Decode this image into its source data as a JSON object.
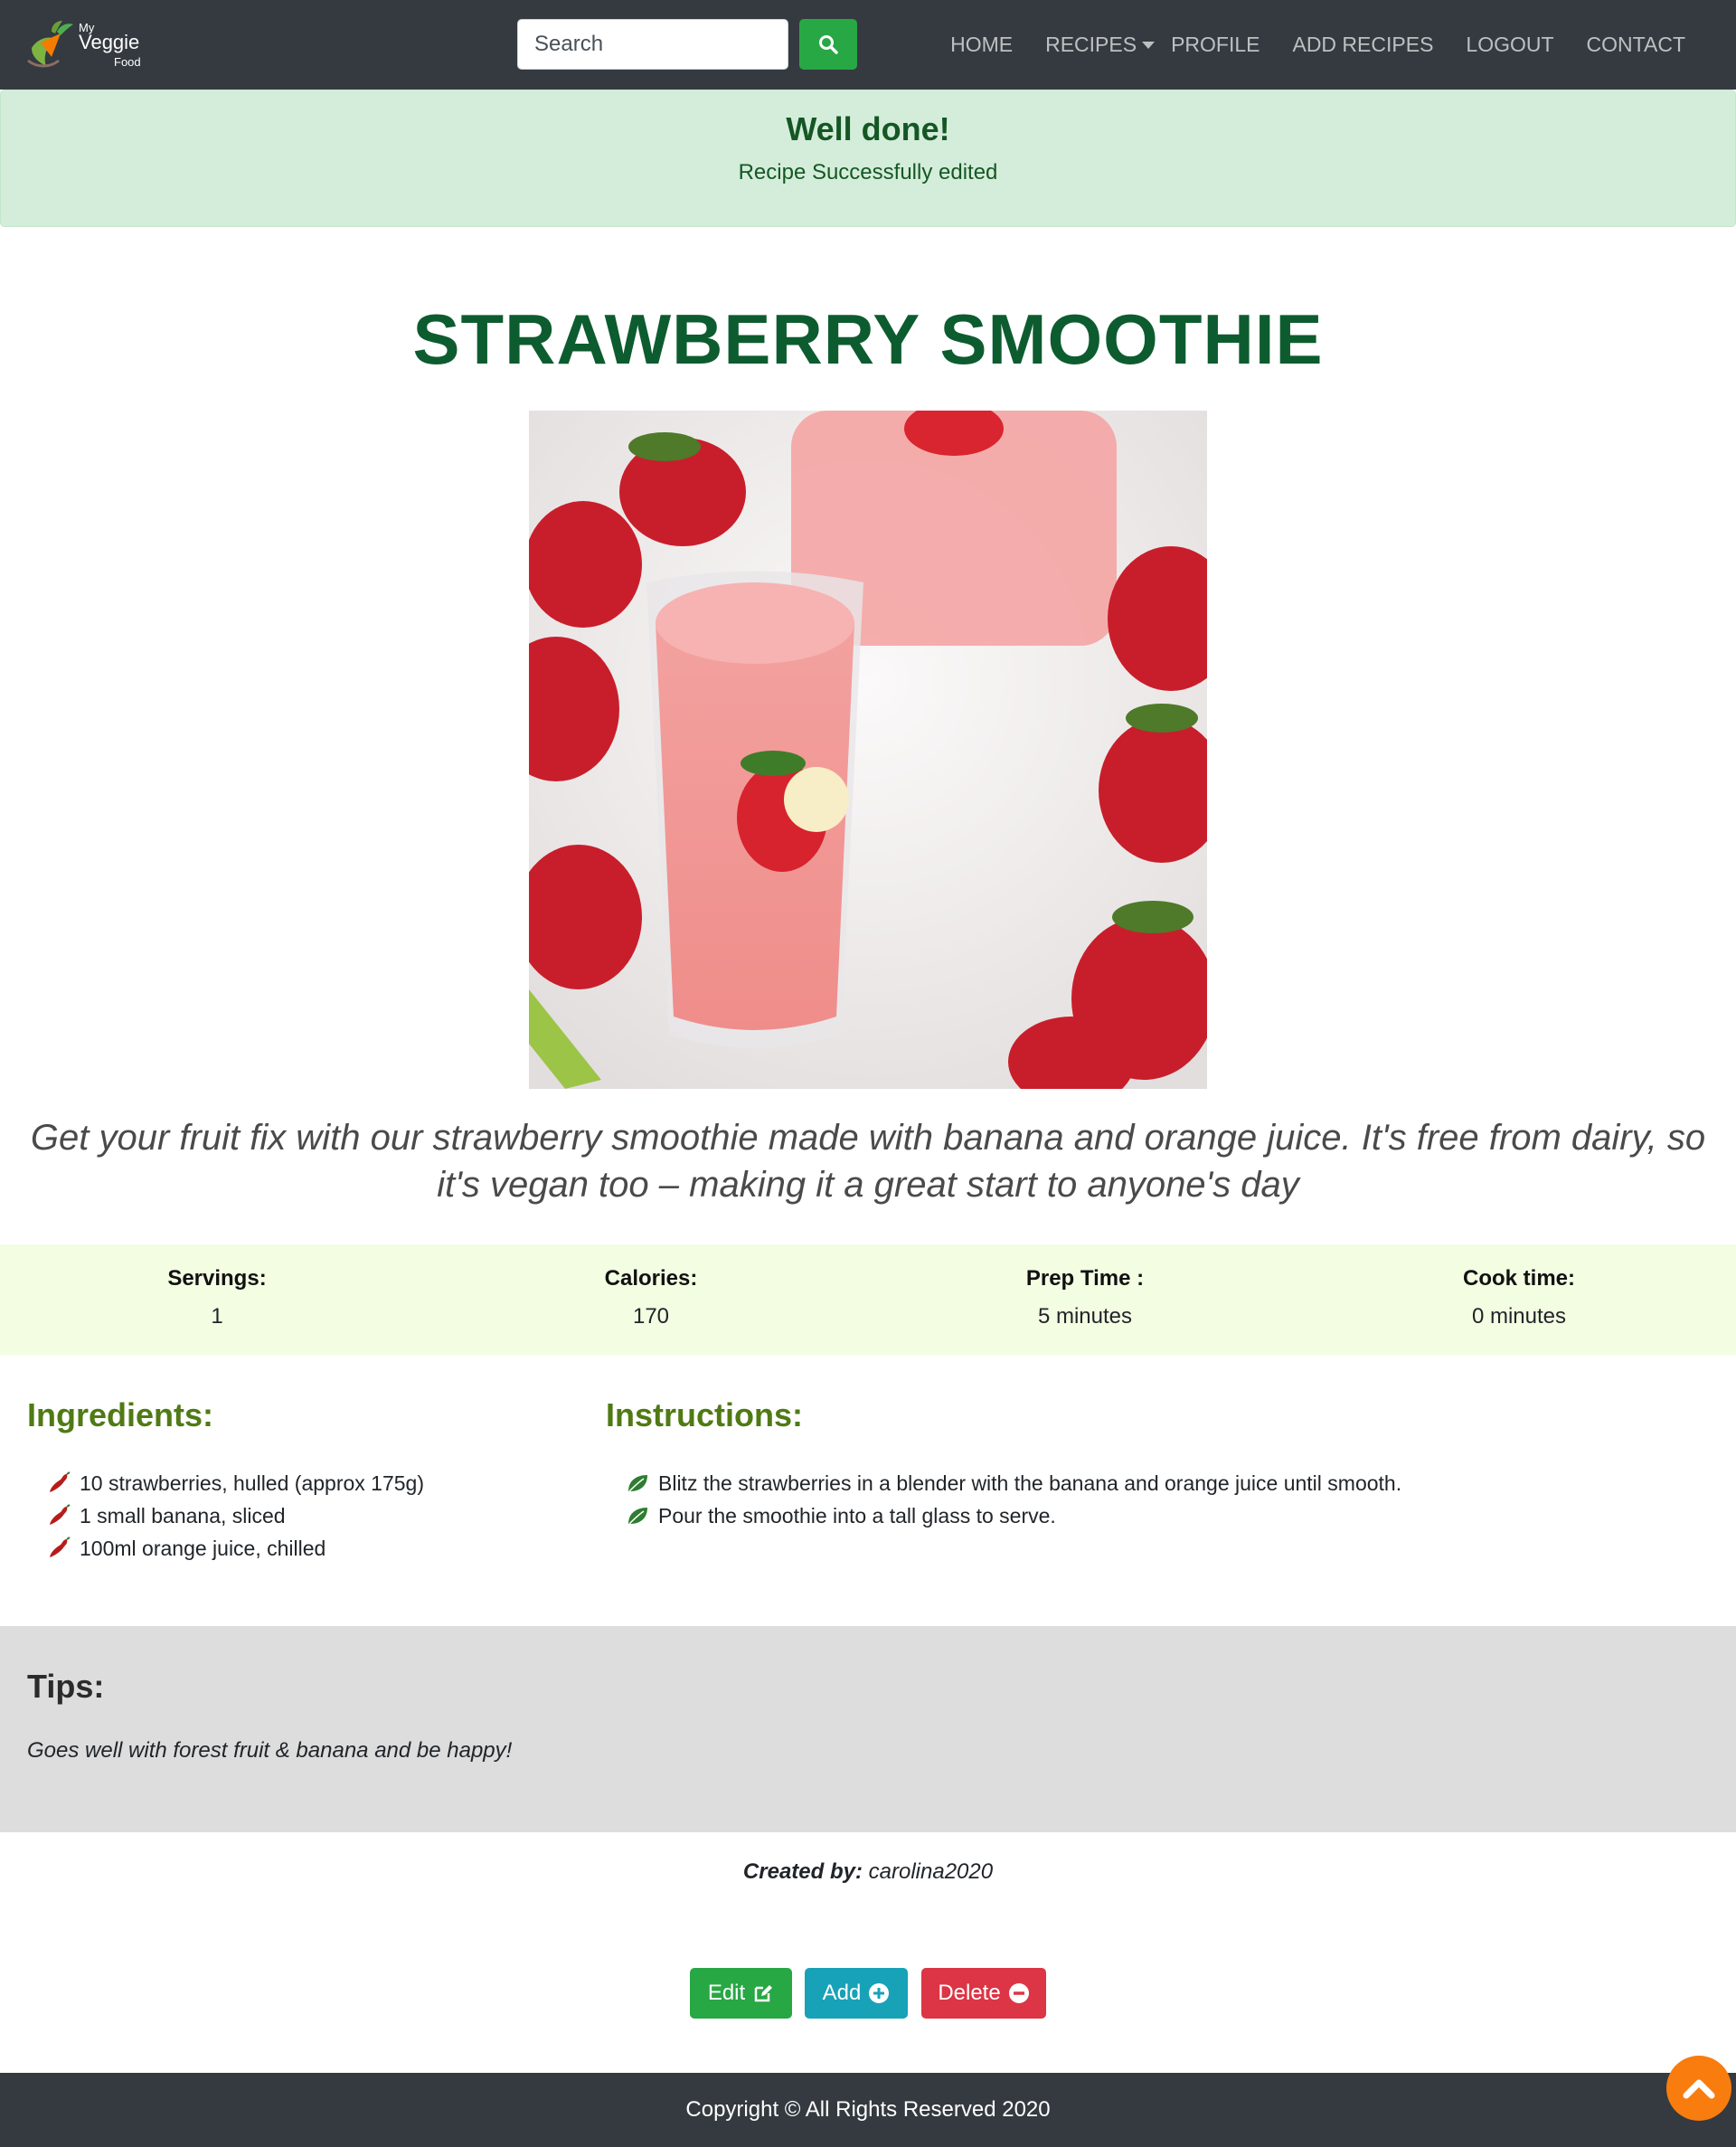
{
  "brand": {
    "line1": "My",
    "line2": "Veggie",
    "line3": "Food"
  },
  "search": {
    "placeholder": "Search"
  },
  "nav": {
    "home": "HOME",
    "recipes": "RECIPES",
    "profile": "PROFILE",
    "add_recipes": "ADD RECIPES",
    "logout": "LOGOUT",
    "contact": "CONTACT"
  },
  "alert": {
    "title": "Well done!",
    "message": "Recipe Successfully edited"
  },
  "recipe": {
    "title": "STRAWBERRY SMOOTHIE",
    "description": "Get your fruit fix with our strawberry smoothie made with banana and orange juice. It's free from dairy, so it's vegan too – making it a great start to anyone's day",
    "stats": [
      {
        "label": "Servings:",
        "value": "1"
      },
      {
        "label": "Calories:",
        "value": "170"
      },
      {
        "label": "Prep Time :",
        "value": "5 minutes"
      },
      {
        "label": "Cook time:",
        "value": "0 minutes"
      }
    ],
    "ingredients_heading": "Ingredients:",
    "ingredients": [
      "10 strawberries, hulled (approx 175g)",
      "1 small banana, sliced",
      "100ml orange juice, chilled"
    ],
    "instructions_heading": "Instructions:",
    "instructions": [
      "Blitz the strawberries in a blender with the banana and orange juice until smooth.",
      "Pour the smoothie into a tall glass to serve."
    ],
    "tips_heading": "Tips:",
    "tips": "Goes well with forest fruit & banana and be happy!",
    "created_label": "Created by:",
    "created_by": "carolina2020"
  },
  "actions": {
    "edit": "Edit",
    "add": "Add",
    "delete": "Delete"
  },
  "footer": {
    "copyright": "Copyright © All Rights Reserved 2020"
  },
  "colors": {
    "navbar": "#343a40",
    "accent_green": "#28a745",
    "info": "#17a2b8",
    "danger": "#dc3545",
    "title_green": "#0d5c2f",
    "heading_olive": "#4f7a14",
    "to_top": "#f97c0f"
  },
  "icons": {
    "search": "search-icon",
    "ingredient_bullet": "chili-pepper-icon",
    "instruction_bullet": "leaf-icon",
    "edit": "edit-icon",
    "add": "plus-circle-icon",
    "delete": "minus-circle-icon",
    "scroll_top": "chevron-up-icon"
  }
}
